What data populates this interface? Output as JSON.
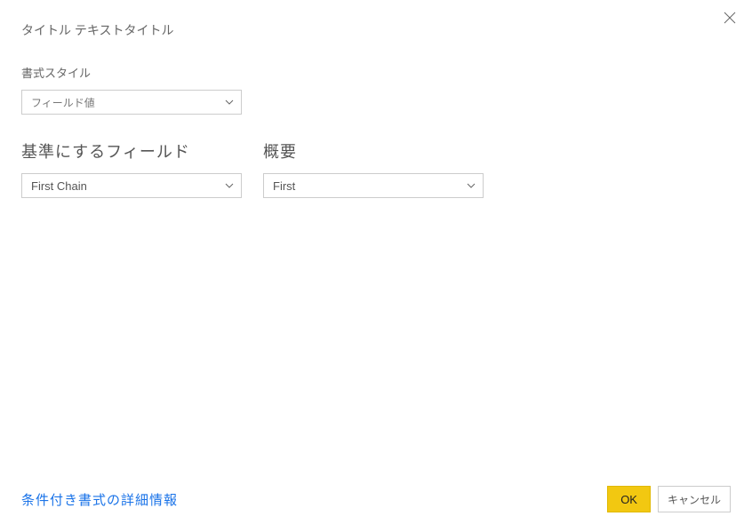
{
  "dialog": {
    "title": "タイトル テキストタイトル"
  },
  "formatStyle": {
    "label": "書式スタイル",
    "value": "フィールド値"
  },
  "baseField": {
    "label": "基準にするフィールド",
    "value": "First Chain"
  },
  "summary": {
    "label": "概要",
    "value": "First"
  },
  "footer": {
    "link": "条件付き書式の詳細情報",
    "ok": "OK",
    "cancel": "キャンセル"
  }
}
